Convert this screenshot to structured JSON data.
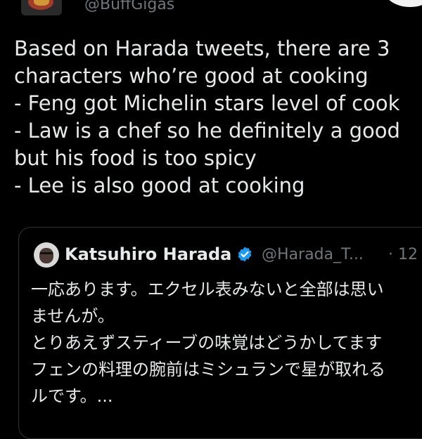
{
  "header": {
    "handle": "@BuffGigas"
  },
  "tweet": {
    "lines": [
      "Based on Harada tweets, there are 3",
      "characters who’re good at cooking",
      "- Feng got Michelin stars level of cook",
      "- Law is a chef so he definitely a good",
      "but his food is too spicy",
      "- Lee is also good at cooking"
    ]
  },
  "quote": {
    "name": "Katsuhiro Harada",
    "handle": "@Harada_T...",
    "time": "· 12",
    "lines": [
      "一応あります。エクセル表みないと全部は思い",
      "ませんが。",
      "とりあえずスティーブの味覚はどうかしてます",
      "フェンの料理の腕前はミシュランで星が取れる",
      "ルです。..."
    ]
  },
  "colors": {
    "background": "#000000",
    "text": "#e7e9ea",
    "muted": "#71767b",
    "verified": "#1d9bf0",
    "border": "#2f3336"
  }
}
